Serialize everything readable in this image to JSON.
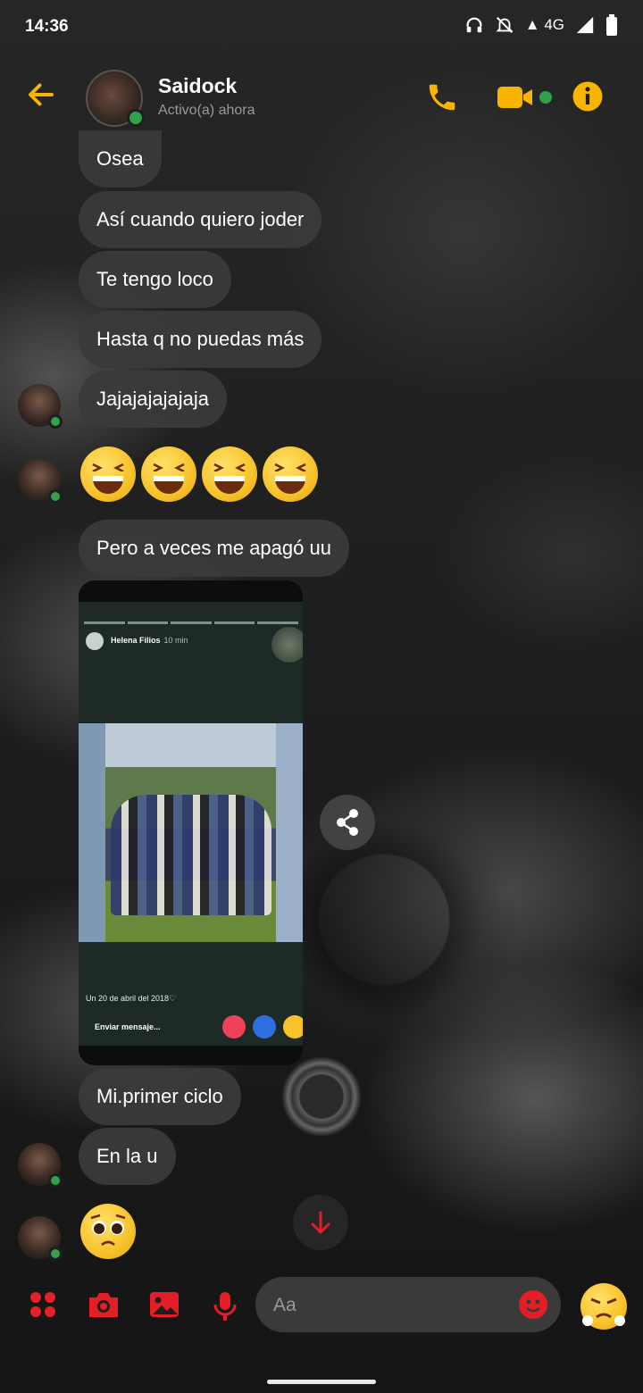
{
  "status_bar": {
    "time": "14:36",
    "network": "4G"
  },
  "header": {
    "contact_name": "Saidock",
    "status": "Activo(a) ahora"
  },
  "messages": [
    {
      "text": "Osea"
    },
    {
      "text": "Así cuando quiero joder"
    },
    {
      "text": "Te tengo loco"
    },
    {
      "text": "Hasta q no puedas más"
    },
    {
      "text": "Jajajajajajaja"
    },
    {
      "text": "Pero a veces me apagó uu"
    },
    {
      "text": "Mi.primer ciclo"
    },
    {
      "text": "En la u"
    }
  ],
  "story_card": {
    "author": "Helena Filios",
    "time": "10 min",
    "caption": "Un 20 de abril del 2018♡",
    "reply_placeholder": "Enviar mensaje..."
  },
  "composer": {
    "placeholder": "Aa"
  },
  "colors": {
    "accent_header": "#f7b500",
    "accent_composer": "#e41e26",
    "online": "#31a24c"
  }
}
